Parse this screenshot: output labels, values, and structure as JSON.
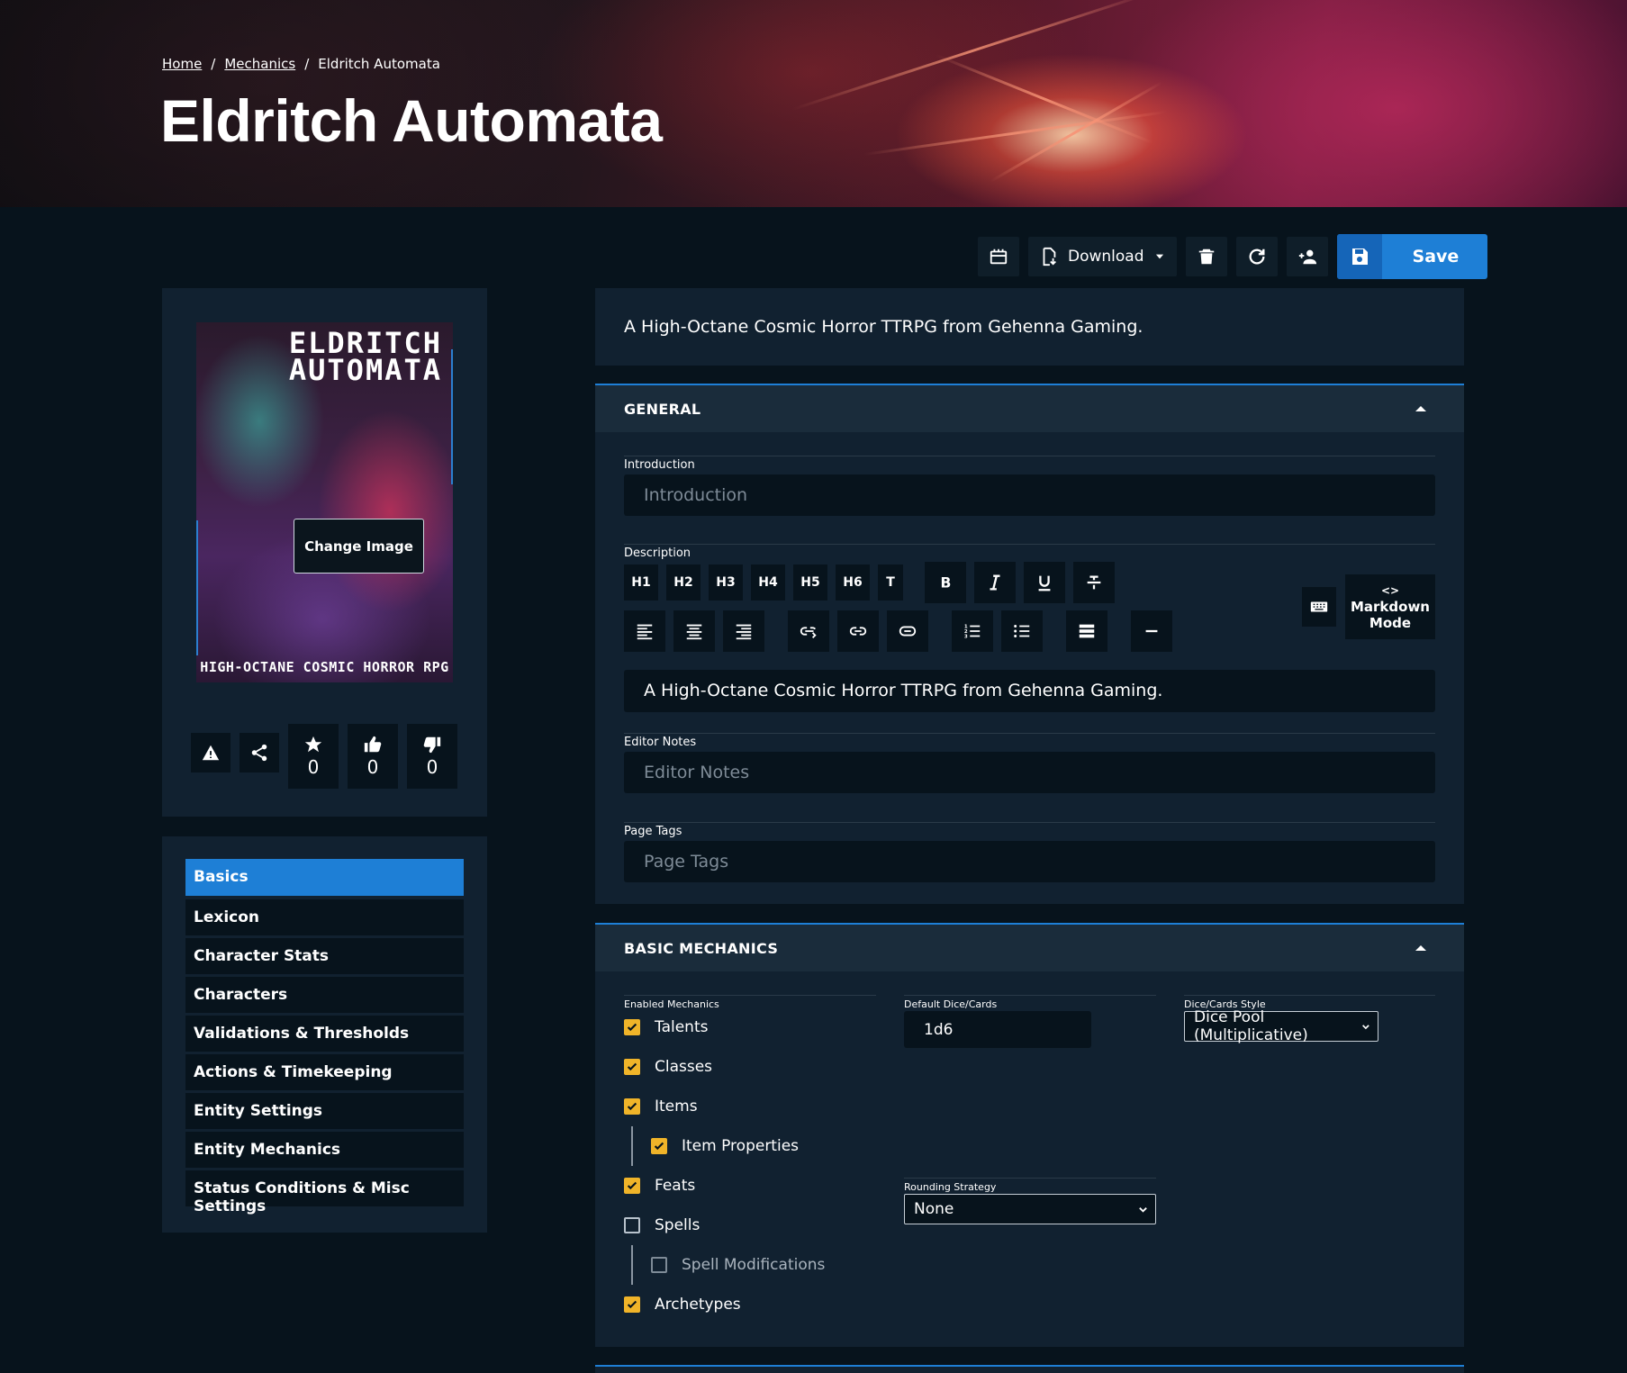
{
  "breadcrumb": {
    "home": "Home",
    "sep1": "/",
    "mechanics": "Mechanics",
    "sep2": "/",
    "current": "Eldritch Automata"
  },
  "page_title": "Eldritch Automata",
  "toolbar": {
    "download_label": "Download",
    "save_label": "Save",
    "icons": [
      "bookshelf-icon",
      "file-download-icon",
      "chevron-down-icon",
      "trash-icon",
      "refresh-icon",
      "add-user-icon",
      "floppy-disk-icon"
    ]
  },
  "cover": {
    "title_line1": "ELDRITCH",
    "title_line2": "AUTOMATA",
    "subtitle": "HIGH-OCTANE COSMIC HORROR RPG",
    "change_image_label": "Change Image"
  },
  "reactions": {
    "favorites": "0",
    "likes": "0",
    "dislikes": "0"
  },
  "nav": {
    "items": [
      {
        "label": "Basics",
        "active": true
      },
      {
        "label": "Lexicon"
      },
      {
        "label": "Character Stats"
      },
      {
        "label": "Characters"
      },
      {
        "label": "Validations & Thresholds"
      },
      {
        "label": "Actions & Timekeeping"
      },
      {
        "label": "Entity Settings"
      },
      {
        "label": "Entity Mechanics"
      },
      {
        "label": "Status Conditions & Misc Settings"
      }
    ]
  },
  "summary": "A High-Octane Cosmic Horror TTRPG from Gehenna Gaming.",
  "general": {
    "title": "GENERAL",
    "introduction_label": "Introduction",
    "introduction_placeholder": "Introduction",
    "description_label": "Description",
    "heading_buttons": [
      "H1",
      "H2",
      "H3",
      "H4",
      "H5",
      "H6",
      "T"
    ],
    "markdown_mode_icon": "<>",
    "markdown_mode_label1": "Markdown",
    "markdown_mode_label2": "Mode",
    "description_value": "A High-Octane Cosmic Horror TTRPG from Gehenna Gaming.",
    "editor_notes_label": "Editor Notes",
    "editor_notes_placeholder": "Editor Notes",
    "page_tags_label": "Page Tags",
    "page_tags_placeholder": "Page Tags"
  },
  "basic_mechanics": {
    "title": "BASIC MECHANICS",
    "enabled_label": "Enabled Mechanics",
    "mechanics": {
      "talents": "Talents",
      "classes": "Classes",
      "items": "Items",
      "item_properties": "Item Properties",
      "feats": "Feats",
      "spells": "Spells",
      "spell_modifications": "Spell Modifications",
      "archetypes": "Archetypes"
    },
    "default_dice_label": "Default Dice/Cards",
    "default_dice_value": "1d6",
    "dice_style_label": "Dice/Cards Style",
    "dice_style_value": "Dice Pool (Multiplicative)",
    "rounding_label": "Rounding Strategy",
    "rounding_value": "None"
  },
  "colors": {
    "accent": "#1e7fd6",
    "checkbox": "#f0b429",
    "panel": "#112130",
    "background": "#07131c"
  }
}
